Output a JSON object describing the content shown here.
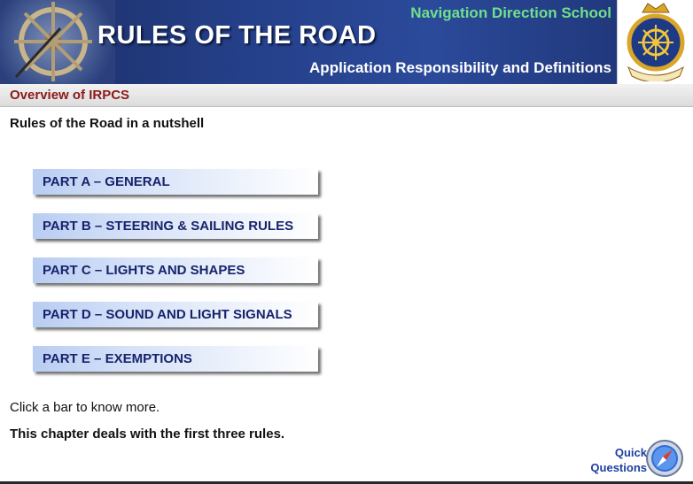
{
  "header": {
    "title": "RULES OF THE ROAD",
    "school": "Navigation Direction School",
    "subtitle": "Application Responsibility and Definitions"
  },
  "section": {
    "title": "Overview of IRPCS"
  },
  "main": {
    "heading": "Rules of the Road in a nutshell",
    "parts": [
      {
        "label": "PART A – GENERAL"
      },
      {
        "label": "PART B – STEERING & SAILING RULES"
      },
      {
        "label": "PART C – LIGHTS AND SHAPES"
      },
      {
        "label": "PART D – SOUND AND LIGHT SIGNALS"
      },
      {
        "label": "PART E – EXEMPTIONS"
      }
    ],
    "instruction": "Click a bar to know more.",
    "chapter_note": "This chapter deals with the first three rules."
  },
  "footer": {
    "quick_line1": "Quick",
    "quick_line2": "Questions",
    "icon": "compass-icon"
  },
  "colors": {
    "header_bg": "#25408a",
    "school_text": "#6fe08a",
    "section_text": "#8a1a18",
    "part_text": "#17236b"
  }
}
